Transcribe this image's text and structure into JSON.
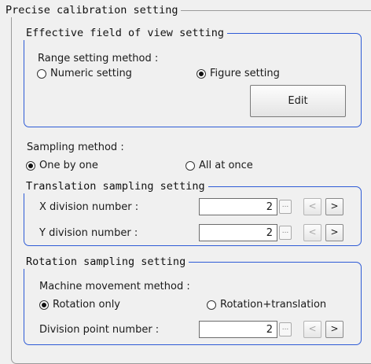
{
  "precise": {
    "title": "Precise calibration setting"
  },
  "fov": {
    "title": "Effective field of view setting",
    "range_label": "Range setting method :",
    "options": [
      {
        "label": "Numeric setting",
        "selected": false
      },
      {
        "label": "Figure setting",
        "selected": true
      }
    ],
    "edit_label": "Edit"
  },
  "sampling": {
    "label": "Sampling method :",
    "options": [
      {
        "label": "One by one",
        "selected": true
      },
      {
        "label": "All at once",
        "selected": false
      }
    ]
  },
  "translation": {
    "title": "Translation sampling setting",
    "x": {
      "label": "X division number :",
      "value": "2"
    },
    "y": {
      "label": "Y division number :",
      "value": "2"
    }
  },
  "rotation": {
    "title": "Rotation sampling setting",
    "machine_label": "Machine movement method :",
    "options": [
      {
        "label": "Rotation only",
        "selected": true
      },
      {
        "label": "Rotation+translation",
        "selected": false
      }
    ],
    "division": {
      "label": "Division point number :",
      "value": "2"
    }
  },
  "controls": {
    "ellipsis": "...",
    "decrement": "<",
    "increment": ">"
  },
  "colors": {
    "group_accent": "#2e5bd6",
    "background": "#f0f0f0"
  }
}
